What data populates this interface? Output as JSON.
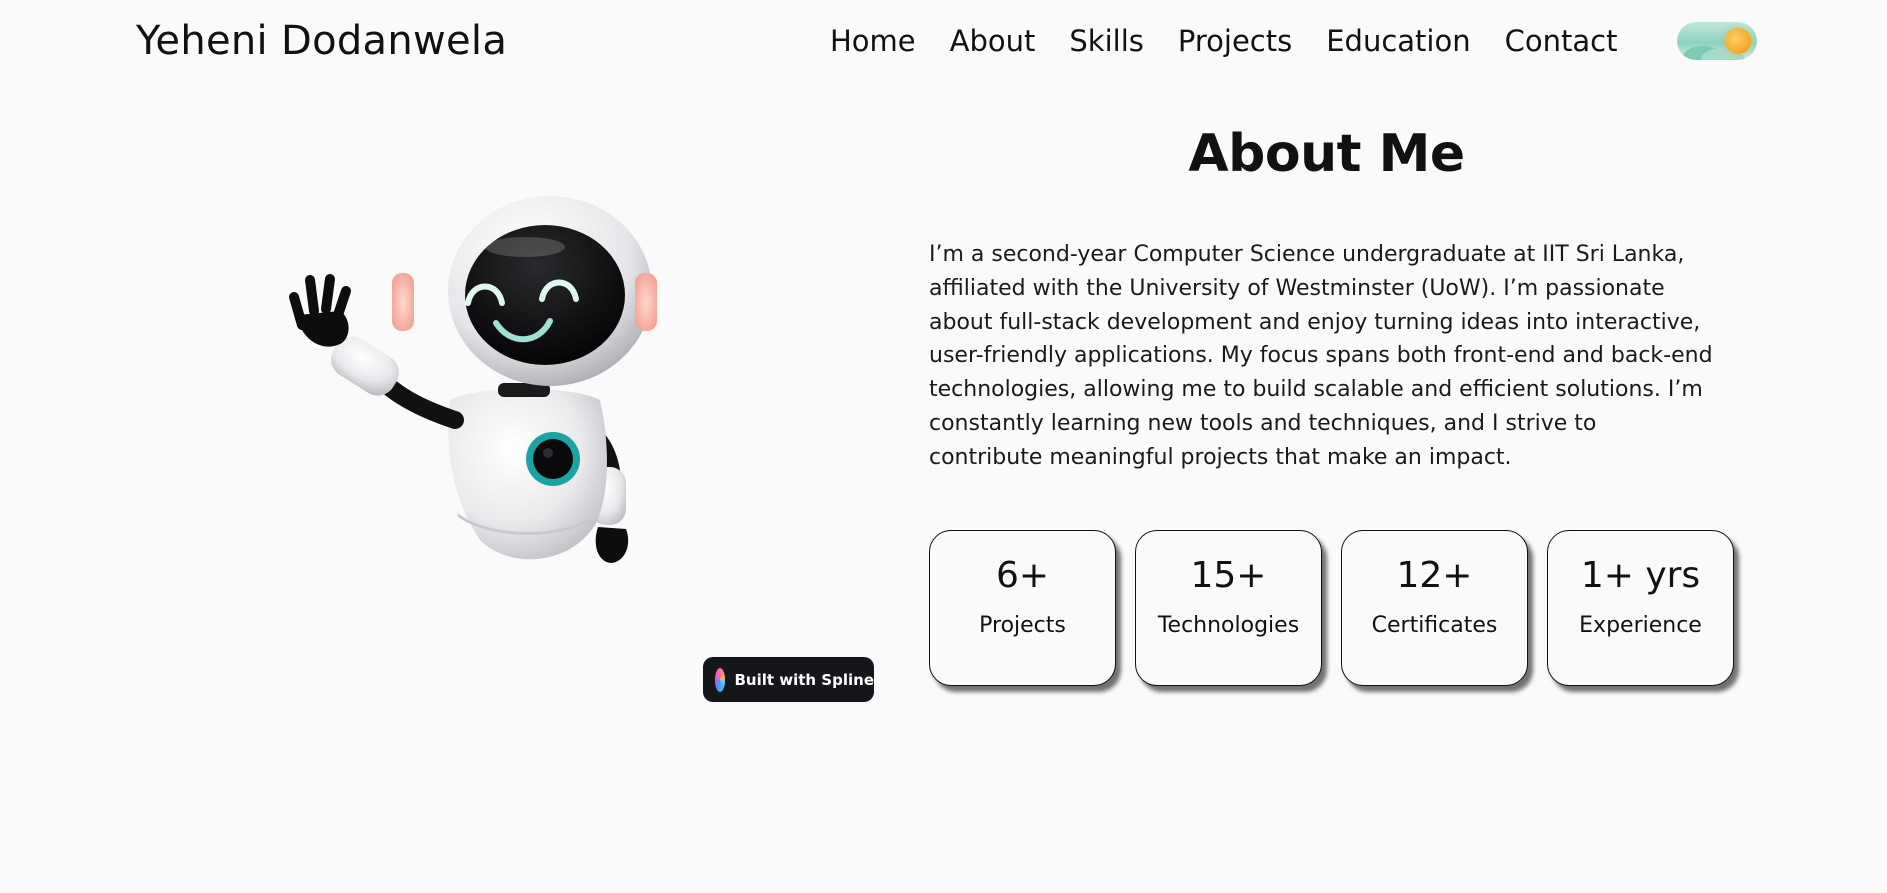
{
  "header": {
    "brand": "Yeheni Dodanwela",
    "nav": [
      "Home",
      "About",
      "Skills",
      "Projects",
      "Education",
      "Contact"
    ],
    "theme_toggle_icon": "sun-icon"
  },
  "hero": {
    "robot_icon": "waving-robot-illustration",
    "spline_badge": "Built with Spline"
  },
  "about": {
    "title": "About Me",
    "text": "I’m a second-year Computer Science undergraduate at IIT Sri Lanka, affiliated with the University of Westminster (UoW). I’m passionate about full-stack development and enjoy turning ideas into interactive, user-friendly applications. My focus spans both front-end and back-end technologies, allowing me to build scalable and efficient solutions. I’m constantly learning new tools and techniques, and I strive to contribute meaningful projects that make an impact.",
    "stats": [
      {
        "value": "6+",
        "label": "Projects"
      },
      {
        "value": "15+",
        "label": "Technologies"
      },
      {
        "value": "12+",
        "label": "Certificates"
      },
      {
        "value": "1+ yrs",
        "label": "Experience"
      }
    ]
  },
  "colors": {
    "background": "#fafafa",
    "text": "#111111",
    "badge_bg": "#15161a",
    "robot_accent": "#1aa3a3"
  }
}
